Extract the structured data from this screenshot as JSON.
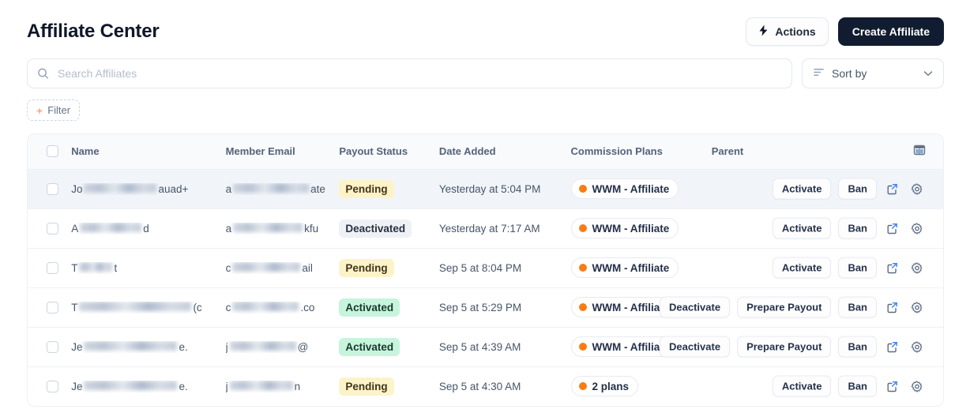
{
  "header": {
    "title": "Affiliate Center",
    "actions_label": "Actions",
    "actions_icon": "bolt-icon",
    "create_label": "Create Affiliate"
  },
  "search": {
    "placeholder": "Search Affiliates",
    "value": "",
    "icon": "search-icon"
  },
  "sort": {
    "label": "Sort by",
    "icon": "sort-lines-icon",
    "chevron": "chevron-down-icon"
  },
  "filter": {
    "label": "Filter",
    "plus": "+"
  },
  "table": {
    "columns": [
      {
        "key": "select",
        "label": ""
      },
      {
        "key": "name",
        "label": "Name"
      },
      {
        "key": "email",
        "label": "Member Email"
      },
      {
        "key": "status",
        "label": "Payout Status"
      },
      {
        "key": "date",
        "label": "Date Added"
      },
      {
        "key": "plans",
        "label": "Commission Plans"
      },
      {
        "key": "parent",
        "label": "Parent"
      },
      {
        "key": "settings",
        "label": ""
      }
    ],
    "column_settings_icon": "column-layout-icon",
    "rows": [
      {
        "name_prefix": "Jo",
        "name_suffix": "auad+",
        "name_redacted": true,
        "email_prefix": "a",
        "email_suffix": "ate",
        "email_redacted": true,
        "status": "Pending",
        "status_type": "pending",
        "date": "Yesterday at 5:04 PM",
        "plan": "WWM - Affiliate",
        "parent": "",
        "actions": [
          "Activate",
          "Ban"
        ],
        "highlighted": true
      },
      {
        "name_prefix": "A",
        "name_suffix": "d",
        "name_redacted": true,
        "email_prefix": "a",
        "email_suffix": "kfu",
        "email_redacted": true,
        "status": "Deactivated",
        "status_type": "deactivated",
        "date": "Yesterday at 7:17 AM",
        "plan": "WWM - Affiliate",
        "parent": "",
        "actions": [
          "Activate",
          "Ban"
        ],
        "highlighted": false
      },
      {
        "name_prefix": "T",
        "name_suffix": "t",
        "name_redacted": true,
        "email_prefix": "c",
        "email_suffix": "ail",
        "email_redacted": true,
        "status": "Pending",
        "status_type": "pending",
        "date": "Sep 5 at 8:04 PM",
        "plan": "WWM - Affiliate",
        "parent": "",
        "actions": [
          "Activate",
          "Ban"
        ],
        "highlighted": false
      },
      {
        "name_prefix": "T",
        "name_suffix": "(c",
        "name_redacted": true,
        "email_prefix": "c",
        "email_suffix": ".co",
        "email_redacted": true,
        "status": "Activated",
        "status_type": "activated",
        "date": "Sep 5 at 5:29 PM",
        "plan": "WWM - Affiliate",
        "parent": "",
        "actions": [
          "Deactivate",
          "Prepare Payout",
          "Ban"
        ],
        "highlighted": false
      },
      {
        "name_prefix": "Je",
        "name_suffix": "e.",
        "name_redacted": true,
        "email_prefix": "j",
        "email_suffix": "@",
        "email_redacted": true,
        "status": "Activated",
        "status_type": "activated",
        "date": "Sep 5 at 4:39 AM",
        "plan": "WWM - Affiliate",
        "parent": "",
        "actions": [
          "Deactivate",
          "Prepare Payout",
          "Ban"
        ],
        "highlighted": false
      },
      {
        "name_prefix": "Je",
        "name_suffix": "e.",
        "name_redacted": true,
        "email_prefix": "j",
        "email_suffix": "n",
        "email_redacted": true,
        "status": "Pending",
        "status_type": "pending",
        "date": "Sep 5 at 4:30 AM",
        "plan": "2 plans",
        "parent": "",
        "actions": [
          "Activate",
          "Ban"
        ],
        "highlighted": false
      }
    ],
    "row_icons": {
      "open": "external-link-icon",
      "settings": "gear-icon"
    }
  },
  "colors": {
    "primary_button": "#111c31",
    "plan_dot": "#f97c16",
    "pending_bg": "#fdf3c9",
    "activated_bg": "#c6f4dd",
    "deactivated_bg": "#eef1f6",
    "accent_plus": "#f28b50"
  }
}
